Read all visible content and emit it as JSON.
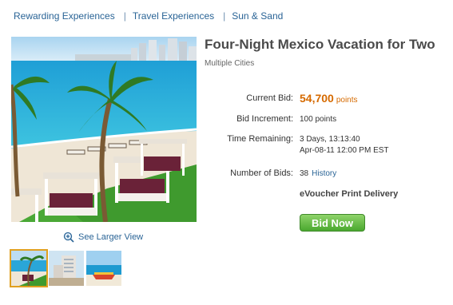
{
  "breadcrumb": {
    "items": [
      "Rewarding Experiences",
      "Travel Experiences",
      "Sun & Sand"
    ],
    "separator": "|"
  },
  "product": {
    "title": "Four-Night Mexico Vacation for Two",
    "subtitle": "Multiple Cities"
  },
  "bid": {
    "current_label": "Current Bid:",
    "current_value": "54,700",
    "current_unit": "points",
    "increment_label": "Bid Increment:",
    "increment_value": "100 points",
    "time_label": "Time Remaining:",
    "time_value_line1": "3 Days, 13:13:40",
    "time_value_line2": "Apr-08-11 12:00 PM EST",
    "num_bids_label": "Number of Bids:",
    "num_bids_value": "38",
    "history_link": "History",
    "delivery": "eVoucher Print Delivery",
    "button": "Bid Now"
  },
  "gallery": {
    "larger_view": "See Larger View",
    "thumbnails": [
      "beach-cabanas",
      "hotel-tower",
      "beach-boat"
    ],
    "selected_index": 0
  },
  "colors": {
    "link": "#2a6496",
    "accent_orange": "#d66a00",
    "button_green": "#4aa82f",
    "title_gray": "#4a4a4a"
  }
}
